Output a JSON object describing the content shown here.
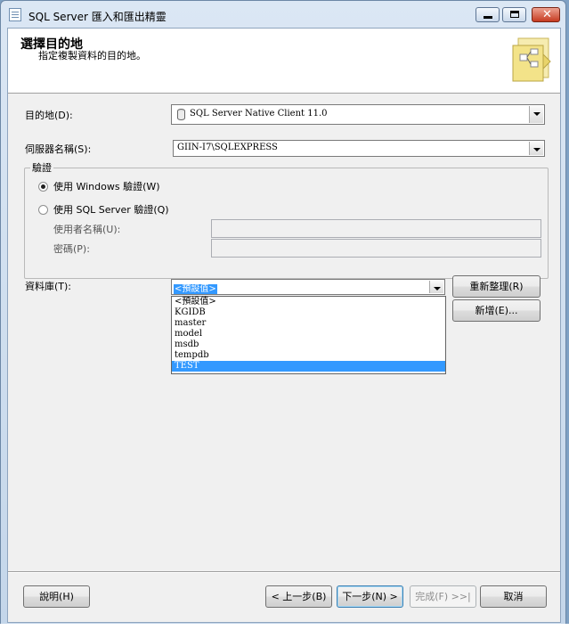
{
  "window": {
    "title": "SQL Server 匯入和匯出精靈"
  },
  "header": {
    "title": "選擇目的地",
    "subtitle": "指定複製資料的目的地。"
  },
  "destination": {
    "label": "目的地(D):",
    "value": "SQL Server Native Client 11.0"
  },
  "server": {
    "label": "伺服器名稱(S):",
    "value": "GIIN-I7\\SQLEXPRESS"
  },
  "auth": {
    "title": "驗證",
    "windows_label": "使用 Windows 驗證(W)",
    "sql_label": "使用 SQL Server 驗證(Q)",
    "username_label": "使用者名稱(U):",
    "password_label": "密碼(P):",
    "selected": "windows"
  },
  "database": {
    "label": "資料庫(T):",
    "value": "<預設值>",
    "options": [
      "<預設值>",
      "KGIDB",
      "master",
      "model",
      "msdb",
      "tempdb",
      "TEST"
    ],
    "highlighted": "TEST",
    "refresh_label": "重新整理(R)",
    "new_label": "新增(E)..."
  },
  "footer": {
    "help": "說明(H)",
    "back": "< 上一步(B)",
    "next": "下一步(N) >",
    "finish": "完成(F) >>|",
    "cancel": "取消"
  }
}
